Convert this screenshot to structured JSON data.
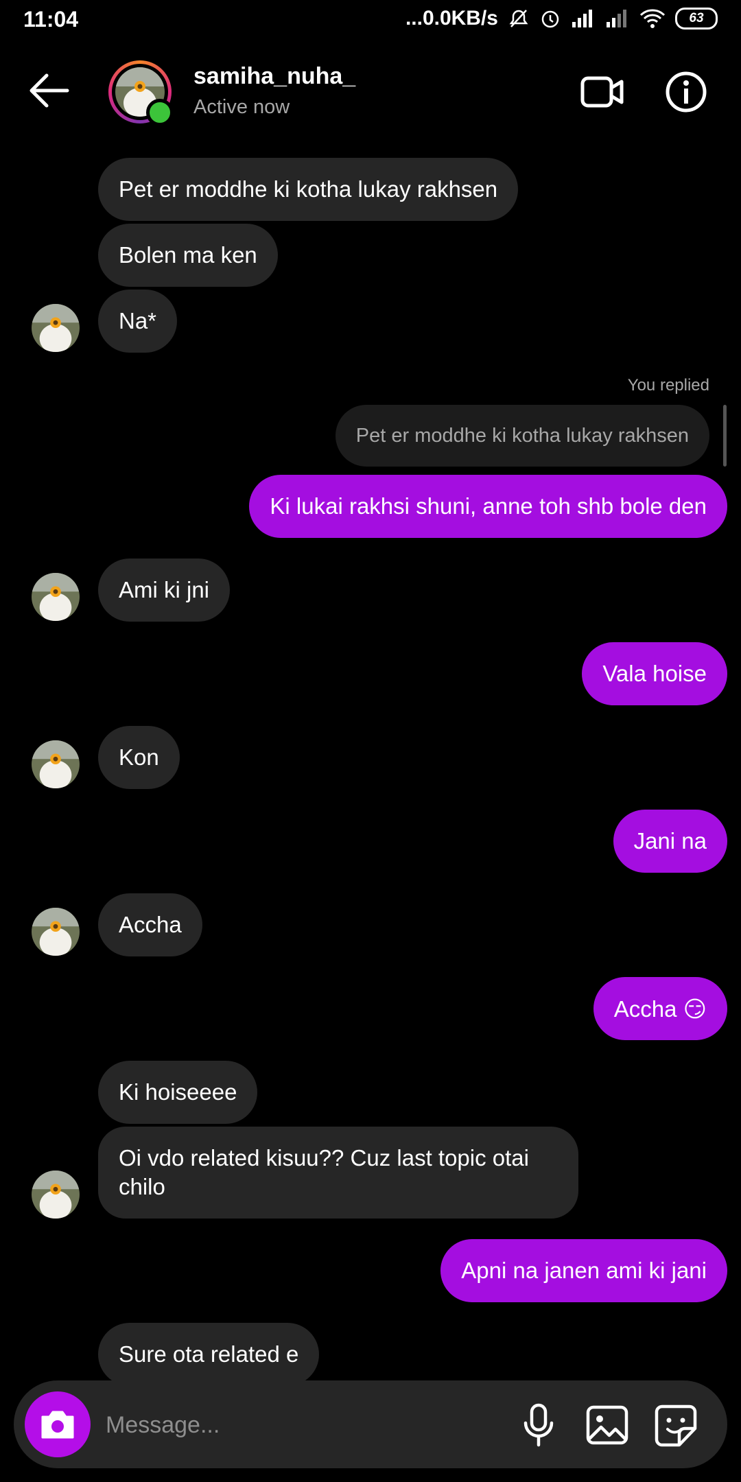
{
  "status_bar": {
    "time": "11:04",
    "network_speed": "...0.0KB/s",
    "battery": "63"
  },
  "header": {
    "username": "samiha_nuha_",
    "status": "Active now"
  },
  "messages": [
    {
      "from": "them",
      "text": "Pet er moddhe ki kotha lukay rakhsen"
    },
    {
      "from": "them",
      "text": "Bolen ma ken"
    },
    {
      "from": "them",
      "text": "Na*"
    },
    {
      "from": "me",
      "reply_label": "You replied",
      "quoted": "Pet er moddhe ki kotha lukay rakhsen",
      "text": "Ki lukai rakhsi shuni, anne toh shb bole den"
    },
    {
      "from": "them",
      "text": "Ami ki jni"
    },
    {
      "from": "me",
      "text": "Vala hoise"
    },
    {
      "from": "them",
      "text": "Kon"
    },
    {
      "from": "me",
      "text": "Jani na"
    },
    {
      "from": "them",
      "text": "Accha"
    },
    {
      "from": "me",
      "text": "Accha 😏"
    },
    {
      "from": "them",
      "text": "Ki hoiseeee"
    },
    {
      "from": "them",
      "text": "Oi vdo related kisuu?? Cuz last topic otai chilo"
    },
    {
      "from": "me",
      "text": "Apni na janen ami ki jani"
    },
    {
      "from": "them",
      "text": "Sure ota related e"
    }
  ],
  "composer": {
    "placeholder": "Message..."
  },
  "colors": {
    "outgoing_bubble": "#a40ee0",
    "incoming_bubble": "#262626",
    "online": "#3cc43a"
  }
}
